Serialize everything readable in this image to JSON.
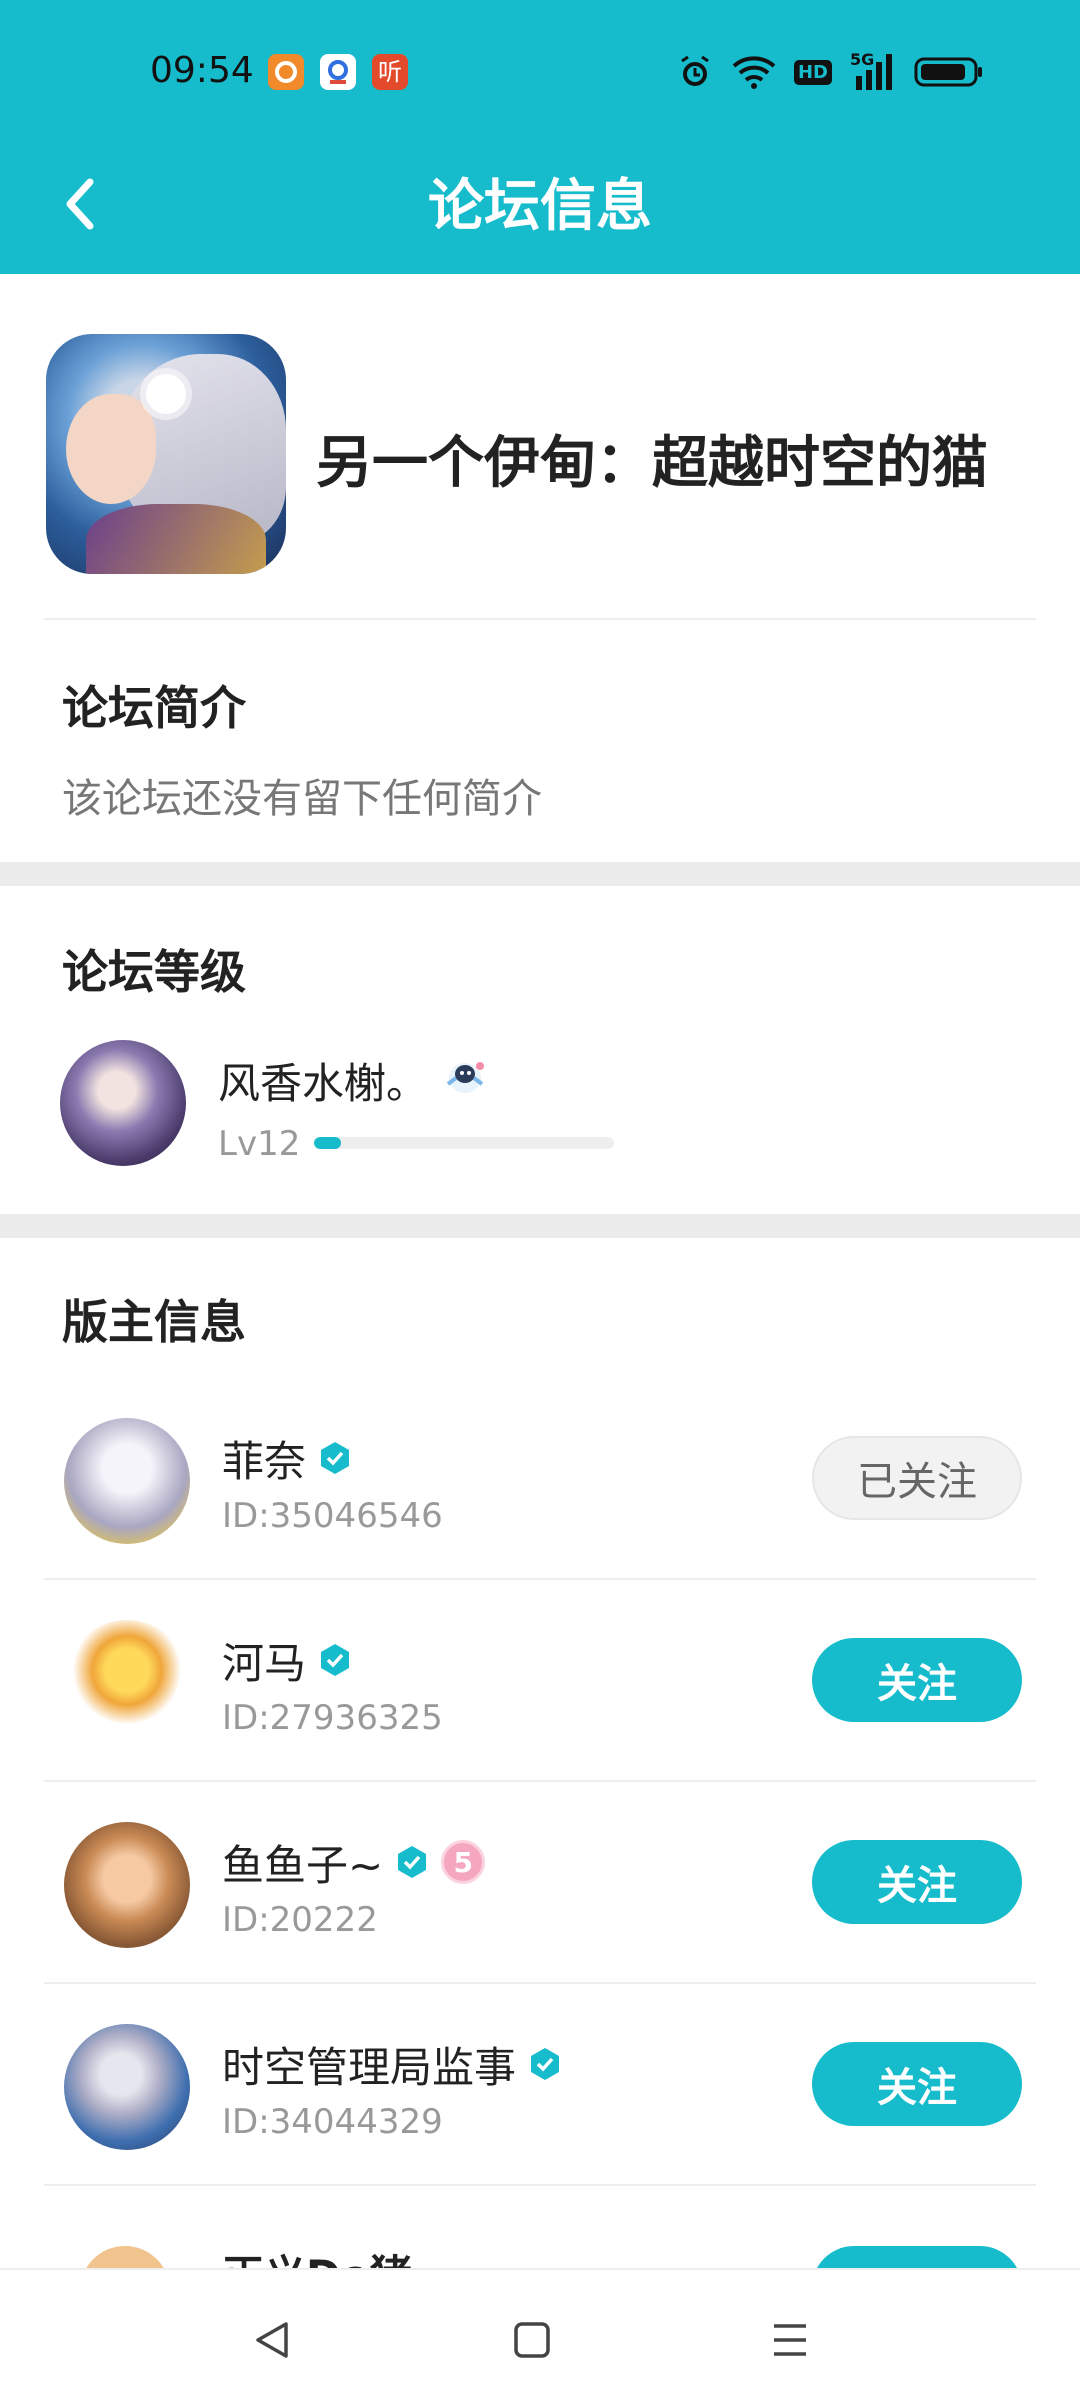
{
  "status_bar": {
    "time": "09:54",
    "notification_icons": [
      "app-orange-icon",
      "app-blue-icon",
      "app-ting-icon"
    ],
    "ting_label": "听",
    "right_icons": [
      "alarm-icon",
      "wifi-icon",
      "hd-icon",
      "signal-5g-icon",
      "battery-icon"
    ],
    "hd_label": "HD",
    "network_label": "5G"
  },
  "header": {
    "title": "论坛信息",
    "background_color": "#16bccb"
  },
  "forum": {
    "name": "另一个伊甸：超越时空的猫"
  },
  "intro": {
    "title": "论坛简介",
    "text": "该论坛还没有留下任何简介"
  },
  "level": {
    "title": "论坛等级",
    "user_name": "风香水榭。",
    "level_label": "Lv12",
    "progress": 0.09
  },
  "moderators": {
    "title": "版主信息",
    "items": [
      {
        "name": "菲奈",
        "id": "ID:35046546",
        "button": "已关注",
        "followed": true,
        "avatar": "av-feinai",
        "badge": ""
      },
      {
        "name": "河马",
        "id": "ID:27936325",
        "button": "关注",
        "followed": false,
        "avatar": "av-hema",
        "badge": ""
      },
      {
        "name": "鱼鱼子~",
        "id": "ID:20222",
        "button": "关注",
        "followed": false,
        "avatar": "av-yuyu",
        "badge": "5"
      },
      {
        "name": "时空管理局监事",
        "id": "ID:34044329",
        "button": "关注",
        "followed": false,
        "avatar": "av-shikong",
        "badge": ""
      }
    ],
    "partial_next_name": "正义Do猪"
  },
  "colors": {
    "accent": "#16bccb",
    "divider": "#ececec"
  }
}
